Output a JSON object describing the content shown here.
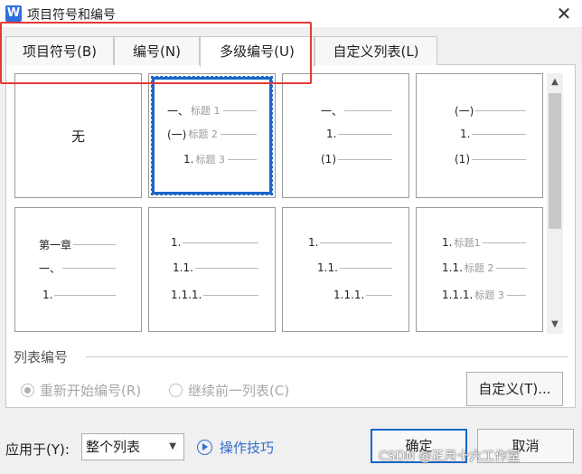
{
  "window": {
    "title": "项目符号和编号",
    "app_icon_letter": "W",
    "close_label": "✕"
  },
  "tabs": [
    {
      "label": "项目符号(B)",
      "active": false
    },
    {
      "label": "编号(N)",
      "active": false
    },
    {
      "label": "多级编号(U)",
      "active": true
    },
    {
      "label": "自定义列表(L)",
      "active": false
    }
  ],
  "gallery": {
    "none_label": "无",
    "cells": [
      {
        "levels": []
      },
      {
        "levels": [
          {
            "num": "一、",
            "text": "标题 1"
          },
          {
            "num": "(一)",
            "text": "标题 2"
          },
          {
            "num": "1.",
            "text": "标题 3"
          }
        ]
      },
      {
        "levels": [
          {
            "num": "一、",
            "text": ""
          },
          {
            "num": "1.",
            "text": ""
          },
          {
            "num": "(1)",
            "text": ""
          }
        ]
      },
      {
        "levels": [
          {
            "num": "(一)",
            "text": ""
          },
          {
            "num": "1.",
            "text": ""
          },
          {
            "num": "(1)",
            "text": ""
          }
        ]
      },
      {
        "levels": [
          {
            "num": "第一章",
            "text": ""
          },
          {
            "num": "一、",
            "text": ""
          },
          {
            "num": "1.",
            "text": ""
          }
        ]
      },
      {
        "levels": [
          {
            "num": "1.",
            "text": ""
          },
          {
            "num": "1.1.",
            "text": ""
          },
          {
            "num": "1.1.1.",
            "text": ""
          }
        ]
      },
      {
        "levels": [
          {
            "num": "1.",
            "text": ""
          },
          {
            "num": "1.1.",
            "text": ""
          },
          {
            "num": "1.1.1.",
            "text": ""
          }
        ]
      },
      {
        "levels": [
          {
            "num": "1.",
            "text": "标题1"
          },
          {
            "num": "1.1.",
            "text": "标题 2"
          },
          {
            "num": "1.1.1.",
            "text": "标题 3"
          }
        ]
      }
    ],
    "selected_index": 1
  },
  "list_numbering": {
    "label": "列表编号",
    "restart_label": "重新开始编号(R)",
    "continue_label": "继续前一列表(C)",
    "customize_label": "自定义(T)..."
  },
  "footer": {
    "apply_label": "应用于(Y):",
    "apply_value": "整个列表",
    "tips_label": "操作技巧",
    "ok_label": "确定",
    "cancel_label": "取消"
  },
  "watermark": "CSDN @正月十六工作室"
}
